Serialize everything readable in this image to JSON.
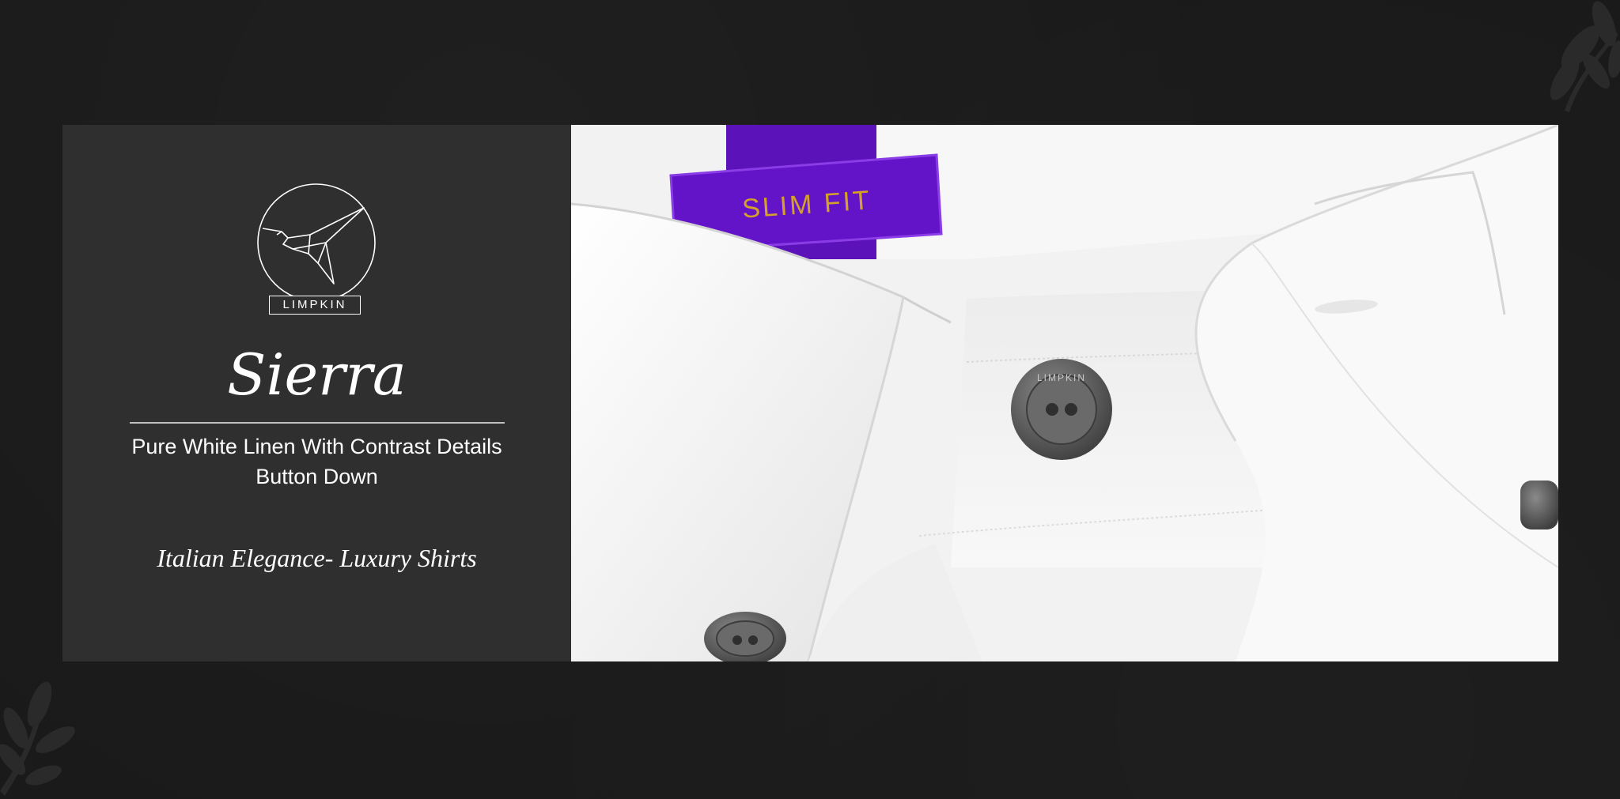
{
  "brand": {
    "name": "LIMPKIN"
  },
  "product": {
    "name": "Sierra",
    "description_line1": "Pure White Linen With Contrast Details",
    "description_line2": "Button Down",
    "tagline": "Italian Elegance- Luxury Shirts"
  },
  "photo": {
    "label_text": "SLIM FIT",
    "button_engraving": "LIMPKIN",
    "colors": {
      "label": "#5b12b8",
      "label_text": "#d4a12a",
      "shirt": "#f3f3f3",
      "button": "#5a5a5a"
    }
  },
  "icons": [
    "origami-bird-logo-icon",
    "leaf-branch-icon"
  ]
}
